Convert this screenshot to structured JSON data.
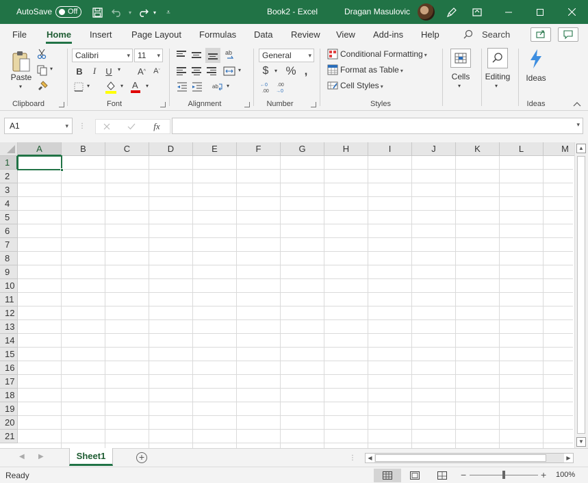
{
  "titlebar": {
    "autosave_label": "AutoSave",
    "autosave_state": "Off",
    "doc_title": "Book2  -  Excel",
    "user_name": "Dragan Masulovic"
  },
  "tabs": [
    {
      "label": "File"
    },
    {
      "label": "Home"
    },
    {
      "label": "Insert"
    },
    {
      "label": "Page Layout"
    },
    {
      "label": "Formulas"
    },
    {
      "label": "Data"
    },
    {
      "label": "Review"
    },
    {
      "label": "View"
    },
    {
      "label": "Add-ins"
    },
    {
      "label": "Help"
    }
  ],
  "search_label": "Search",
  "ribbon": {
    "clipboard": {
      "label": "Clipboard",
      "paste": "Paste"
    },
    "font": {
      "label": "Font",
      "name": "Calibri",
      "size": "11"
    },
    "alignment": {
      "label": "Alignment"
    },
    "number": {
      "label": "Number",
      "format": "General"
    },
    "styles": {
      "label": "Styles",
      "conditional": "Conditional Formatting",
      "format_table": "Format as Table",
      "cell_styles": "Cell Styles"
    },
    "cells": {
      "label": "Cells"
    },
    "editing": {
      "label": "Editing"
    },
    "ideas": {
      "label": "Ideas",
      "button": "Ideas"
    }
  },
  "formula_bar": {
    "name_box": "A1",
    "fx": "fx",
    "value": ""
  },
  "grid": {
    "columns": [
      "A",
      "B",
      "C",
      "D",
      "E",
      "F",
      "G",
      "H",
      "I",
      "J",
      "K",
      "L",
      "M"
    ],
    "rows": [
      "1",
      "2",
      "3",
      "4",
      "5",
      "6",
      "7",
      "8",
      "9",
      "10",
      "11",
      "12",
      "13",
      "14",
      "15",
      "16",
      "17",
      "18",
      "19",
      "20",
      "21"
    ],
    "selected_cell": "A1"
  },
  "sheets": [
    {
      "label": "Sheet1",
      "active": true
    }
  ],
  "status": {
    "text": "Ready",
    "zoom": "100%",
    "zoom_level": 1.0
  }
}
